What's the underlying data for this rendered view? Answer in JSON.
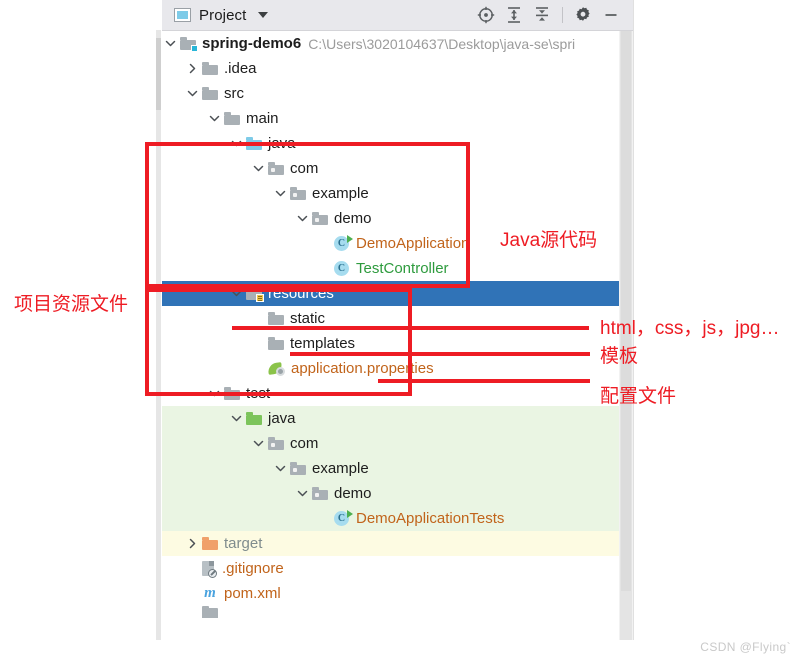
{
  "tool_window": {
    "tab_label": "Project",
    "tab_icon": "project-panel-icon",
    "caret_icon": "chevron-down-icon",
    "actions": [
      {
        "name": "select-opened-file-button",
        "icon": "crosshair-target-icon"
      },
      {
        "name": "expand-all-button",
        "icon": "expand-all-icon"
      },
      {
        "name": "collapse-all-button",
        "icon": "collapse-all-icon"
      },
      {
        "name": "settings-button",
        "icon": "gear-icon"
      },
      {
        "name": "hide-button",
        "icon": "minimize-icon"
      }
    ]
  },
  "tree": [
    {
      "id": "spring-demo6",
      "label": "spring-demo6",
      "path": "C:\\Users\\3020104637\\Desktop\\java-se\\spri",
      "indent": 0,
      "twisty": "expanded",
      "icon": "module-folder-icon",
      "bold": true
    },
    {
      "id": "idea",
      "label": ".idea",
      "indent": 1,
      "twisty": "collapsed",
      "icon": "folder-grey-icon"
    },
    {
      "id": "src",
      "label": "src",
      "indent": 1,
      "twisty": "expanded",
      "icon": "folder-grey-icon"
    },
    {
      "id": "main",
      "label": "main",
      "indent": 2,
      "twisty": "expanded",
      "icon": "folder-grey-icon"
    },
    {
      "id": "main-java",
      "label": "java",
      "indent": 3,
      "twisty": "expanded",
      "icon": "source-root-blue-folder-icon"
    },
    {
      "id": "main-com",
      "label": "com",
      "indent": 4,
      "twisty": "expanded",
      "icon": "package-icon"
    },
    {
      "id": "main-example",
      "label": "example",
      "indent": 5,
      "twisty": "expanded",
      "icon": "package-icon"
    },
    {
      "id": "main-demo",
      "label": "demo",
      "indent": 6,
      "twisty": "expanded",
      "icon": "package-icon"
    },
    {
      "id": "DemoApplication",
      "label": "DemoApplication",
      "indent": 7,
      "twisty": "none",
      "icon": "java-class-runnable-icon",
      "color": "orange"
    },
    {
      "id": "TestController",
      "label": "TestController",
      "indent": 7,
      "twisty": "none",
      "icon": "java-class-icon",
      "color": "green"
    },
    {
      "id": "resources",
      "label": "resources",
      "indent": 3,
      "twisty": "expanded",
      "icon": "resource-root-folder-icon",
      "selected": true
    },
    {
      "id": "static",
      "label": "static",
      "indent": 4,
      "twisty": "none",
      "icon": "folder-grey-icon"
    },
    {
      "id": "templates",
      "label": "templates",
      "indent": 4,
      "twisty": "none",
      "icon": "folder-grey-icon"
    },
    {
      "id": "application.properties",
      "label": "application.properties",
      "indent": 4,
      "twisty": "none",
      "icon": "spring-properties-icon",
      "color": "orange"
    },
    {
      "id": "test",
      "label": "test",
      "indent": 2,
      "twisty": "expanded",
      "icon": "folder-grey-icon"
    },
    {
      "id": "test-java",
      "label": "java",
      "indent": 3,
      "twisty": "expanded",
      "icon": "test-source-root-green-folder-icon",
      "rowbg": "green"
    },
    {
      "id": "test-com",
      "label": "com",
      "indent": 4,
      "twisty": "expanded",
      "icon": "package-icon",
      "rowbg": "green"
    },
    {
      "id": "test-example",
      "label": "example",
      "indent": 5,
      "twisty": "expanded",
      "icon": "package-icon",
      "rowbg": "green"
    },
    {
      "id": "test-demo",
      "label": "demo",
      "indent": 6,
      "twisty": "expanded",
      "icon": "package-icon",
      "rowbg": "green"
    },
    {
      "id": "DemoApplicationTests",
      "label": "DemoApplicationTests",
      "indent": 7,
      "twisty": "none",
      "icon": "java-class-runnable-icon",
      "color": "orange",
      "rowbg": "green"
    },
    {
      "id": "target",
      "label": "target",
      "indent": 1,
      "twisty": "collapsed",
      "icon": "excluded-folder-orange-icon",
      "color": "grey",
      "rowbg": "yellow"
    },
    {
      "id": "gitignore",
      "label": ".gitignore",
      "indent": 1,
      "twisty": "none",
      "icon": "gitignore-file-icon",
      "color": "orange"
    },
    {
      "id": "pom.xml",
      "label": "pom.xml",
      "indent": 1,
      "twisty": "none",
      "icon": "maven-pom-icon",
      "color": "orange"
    }
  ],
  "annotations": {
    "java_source": "Java源代码",
    "project_resources": "项目资源文件",
    "static_files": "html，css，js，jpg…",
    "templates": "模板",
    "config_file": "配置文件",
    "color": "#ee1c24"
  },
  "watermark": "CSDN @Flying`"
}
